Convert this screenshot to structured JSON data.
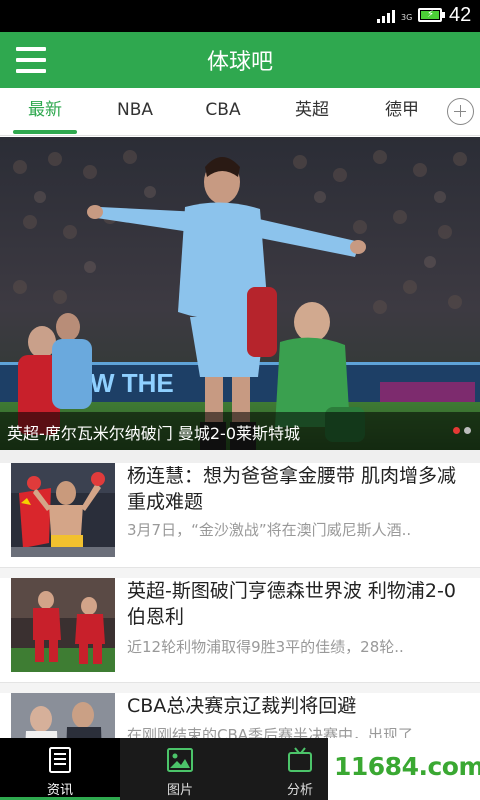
{
  "status_bar": {
    "network": "3G",
    "time": "42"
  },
  "app_bar": {
    "title": "体球吧",
    "menu_icon": "hamburger-menu-icon"
  },
  "tabs": [
    {
      "label": "最新",
      "active": true
    },
    {
      "label": "NBA",
      "active": false
    },
    {
      "label": "CBA",
      "active": false
    },
    {
      "label": "英超",
      "active": false
    },
    {
      "label": "德甲",
      "active": false
    }
  ],
  "add_tab_icon": "plus-circle-icon",
  "banner": {
    "caption": "英超-席尔瓦米尔纳破门 曼城2-0莱斯特城",
    "slides": 2,
    "active_slide": 1
  },
  "news": [
    {
      "title": "杨连慧：想为爸爸拿金腰带 肌肉增多减重成难题",
      "desc": "3月7日，“金沙激战”将在澳门威尼斯人酒.."
    },
    {
      "title": "英超-斯图破门亨德森世界波 利物浦2-0伯恩利",
      "desc": "近12轮利物浦取得9胜3平的佳绩，28轮.."
    },
    {
      "title": "CBA总决赛京辽裁判将回避",
      "desc": "在刚刚结束的CBA季后赛半决赛中，出现了.."
    }
  ],
  "bottom_nav": [
    {
      "label": "资讯",
      "icon": "news-document-icon",
      "active": true
    },
    {
      "label": "图片",
      "icon": "image-icon",
      "active": false
    },
    {
      "label": "分析",
      "icon": "tv-icon",
      "active": false
    }
  ],
  "watermark": "11684.com",
  "colors": {
    "brand_green": "#2fa84f",
    "status_bar": "#000000",
    "bottom_nav": "#1a1a1a"
  }
}
